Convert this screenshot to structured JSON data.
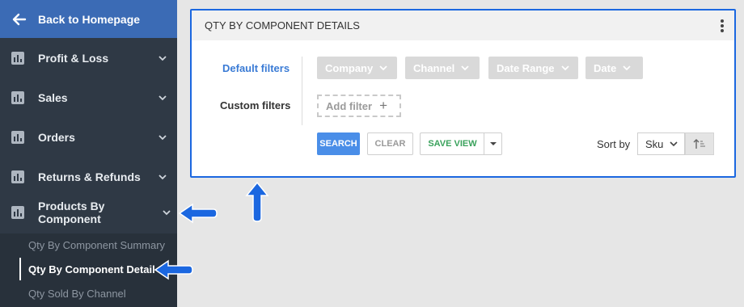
{
  "sidebar": {
    "back_label": "Back to Homepage",
    "items": [
      {
        "label": "Profit & Loss"
      },
      {
        "label": "Sales"
      },
      {
        "label": "Orders"
      },
      {
        "label": "Returns & Refunds"
      },
      {
        "label": "Products By Component"
      }
    ],
    "sub_items": [
      {
        "label": "Qty By Component Summary"
      },
      {
        "label": "Qty By Component Detail"
      },
      {
        "label": "Qty Sold By Channel"
      }
    ]
  },
  "panel": {
    "title": "QTY BY COMPONENT DETAILS",
    "default_filters_label": "Default filters",
    "custom_filters_label": "Custom filters",
    "filters": [
      {
        "label": "Company"
      },
      {
        "label": "Channel"
      },
      {
        "label": "Date Range"
      },
      {
        "label": "Date"
      }
    ],
    "add_filter_label": "Add filter",
    "search_label": "SEARCH",
    "clear_label": "CLEAR",
    "save_view_label": "SAVE VIEW",
    "sort_by_label": "Sort by",
    "sort_value": "Sku"
  },
  "colors": {
    "sidebar_bg": "#2f3945",
    "back_bar_bg": "#3b6bb5",
    "accent": "#1b67e0",
    "search_btn": "#4a8ee8",
    "save_view_text": "#3aa25c",
    "default_filters_text": "#3a7bd5"
  },
  "icons": {
    "back": "arrow-left-icon",
    "nav": "bar-chart-icon",
    "chevron": "chevron-down-icon",
    "menu": "kebab-menu-icon",
    "add": "plus-icon",
    "sort": "sort-ascending-icon",
    "callout": "blue-arrow-icon"
  }
}
